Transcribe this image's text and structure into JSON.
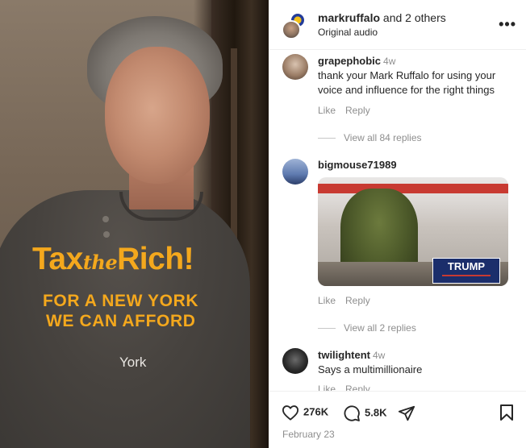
{
  "media": {
    "shirt_line1_a": "Tax",
    "shirt_line1_b": "the",
    "shirt_line1_c": "Rich!",
    "shirt_line2": "FOR A NEW YORK",
    "shirt_line3": "WE CAN AFFORD",
    "shirt_small": "York",
    "accent_color": "#f4a81d"
  },
  "header": {
    "author": "markruffalo",
    "collab": "and 2 others",
    "audio": "Original audio",
    "more_icon": "more-horizontal-icon"
  },
  "comments": [
    {
      "user": "grapephobic",
      "time": "4w",
      "text": "thank your Mark Ruffalo for using your voice and influence for the right things",
      "like": "Like",
      "reply": "Reply",
      "view_replies": "View all 84 replies"
    },
    {
      "user": "bigmouse71989",
      "image_sign": "TRUMP",
      "like": "Like",
      "reply": "Reply",
      "view_replies": "View all 2 replies"
    },
    {
      "user": "twilightent",
      "time": "4w",
      "text": "Says a multimillionaire",
      "like": "Like",
      "reply": "Reply"
    }
  ],
  "footer": {
    "likes": "276K",
    "comments": "5.8K",
    "date": "February 23",
    "icons": [
      "heart-icon",
      "comment-icon",
      "share-icon",
      "bookmark-icon"
    ]
  }
}
